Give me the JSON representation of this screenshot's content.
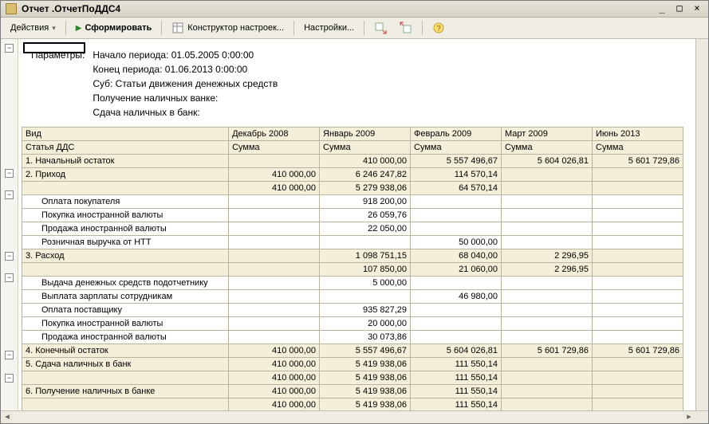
{
  "window": {
    "title": "Отчет  .ОтчетПоДДС4"
  },
  "toolbar": {
    "actions": "Действия",
    "form": "Сформировать",
    "constructor": "Конструктор настроек...",
    "settings": "Настройки..."
  },
  "params": {
    "label": "Параметры:",
    "start": "Начало периода: 01.05.2005 0:00:00",
    "end": "Конец периода: 01.06.2013 0:00:00",
    "sub": "Суб: Статьи движения денежных средств",
    "receive": "Получение наличных ванке:",
    "deposit": "Сдача наличных в банк:"
  },
  "headers": {
    "kind": "Вид",
    "article": "Статья ДДС",
    "c1": "Декабрь 2008",
    "c2": "Январь 2009",
    "c3": "Февраль 2009",
    "c4": "Март 2009",
    "c5": "Июнь 2013",
    "sum": "Сумма"
  },
  "rows": {
    "r1": {
      "name": "1. Начальный остаток",
      "v": [
        "",
        "410 000,00",
        "5 557 496,67",
        "5 604 026,81",
        "5 601 729,86"
      ]
    },
    "r2": {
      "name": "2. Приход",
      "v": [
        "410 000,00",
        "6 246 247,82",
        "114 570,14",
        "",
        ""
      ]
    },
    "r2a": {
      "name": "",
      "v": [
        "410 000,00",
        "5 279 938,06",
        "64 570,14",
        "",
        ""
      ]
    },
    "r3": {
      "name": "Оплата покупателя",
      "v": [
        "",
        "918 200,00",
        "",
        "",
        ""
      ]
    },
    "r4": {
      "name": "Покупка иностранной валюты",
      "v": [
        "",
        "26 059,76",
        "",
        "",
        ""
      ]
    },
    "r5": {
      "name": "Продажа иностранной валюты",
      "v": [
        "",
        "22 050,00",
        "",
        "",
        ""
      ]
    },
    "r6": {
      "name": "Розничная выручка от НТТ",
      "v": [
        "",
        "",
        "50 000,00",
        "",
        ""
      ]
    },
    "r7": {
      "name": "3. Расход",
      "v": [
        "",
        "1 098 751,15",
        "68 040,00",
        "2 296,95",
        ""
      ]
    },
    "r7a": {
      "name": "",
      "v": [
        "",
        "107 850,00",
        "21 060,00",
        "2 296,95",
        ""
      ]
    },
    "r8": {
      "name": "Выдача денежных средств подотчетнику",
      "v": [
        "",
        "5 000,00",
        "",
        "",
        ""
      ]
    },
    "r9": {
      "name": "Выплата зарплаты сотрудникам",
      "v": [
        "",
        "",
        "46 980,00",
        "",
        ""
      ]
    },
    "r10": {
      "name": "Оплата поставщику",
      "v": [
        "",
        "935 827,29",
        "",
        "",
        ""
      ]
    },
    "r11": {
      "name": "Покупка иностранной валюты",
      "v": [
        "",
        "20 000,00",
        "",
        "",
        ""
      ]
    },
    "r12": {
      "name": "Продажа иностранной валюты",
      "v": [
        "",
        "30 073,86",
        "",
        "",
        ""
      ]
    },
    "r13": {
      "name": "4. Конечный остаток",
      "v": [
        "410 000,00",
        "5 557 496,67",
        "5 604 026,81",
        "5 601 729,86",
        "5 601 729,86"
      ]
    },
    "r14": {
      "name": "5. Сдача наличных в банк",
      "v": [
        "410 000,00",
        "5 419 938,06",
        "111 550,14",
        "",
        ""
      ]
    },
    "r14a": {
      "name": "",
      "v": [
        "410 000,00",
        "5 419 938,06",
        "111 550,14",
        "",
        ""
      ]
    },
    "r15": {
      "name": "6. Получение наличных в банке",
      "v": [
        "410 000,00",
        "5 419 938,06",
        "111 550,14",
        "",
        ""
      ]
    },
    "r15a": {
      "name": "",
      "v": [
        "410 000,00",
        "5 419 938,06",
        "111 550,14",
        "",
        ""
      ]
    }
  }
}
